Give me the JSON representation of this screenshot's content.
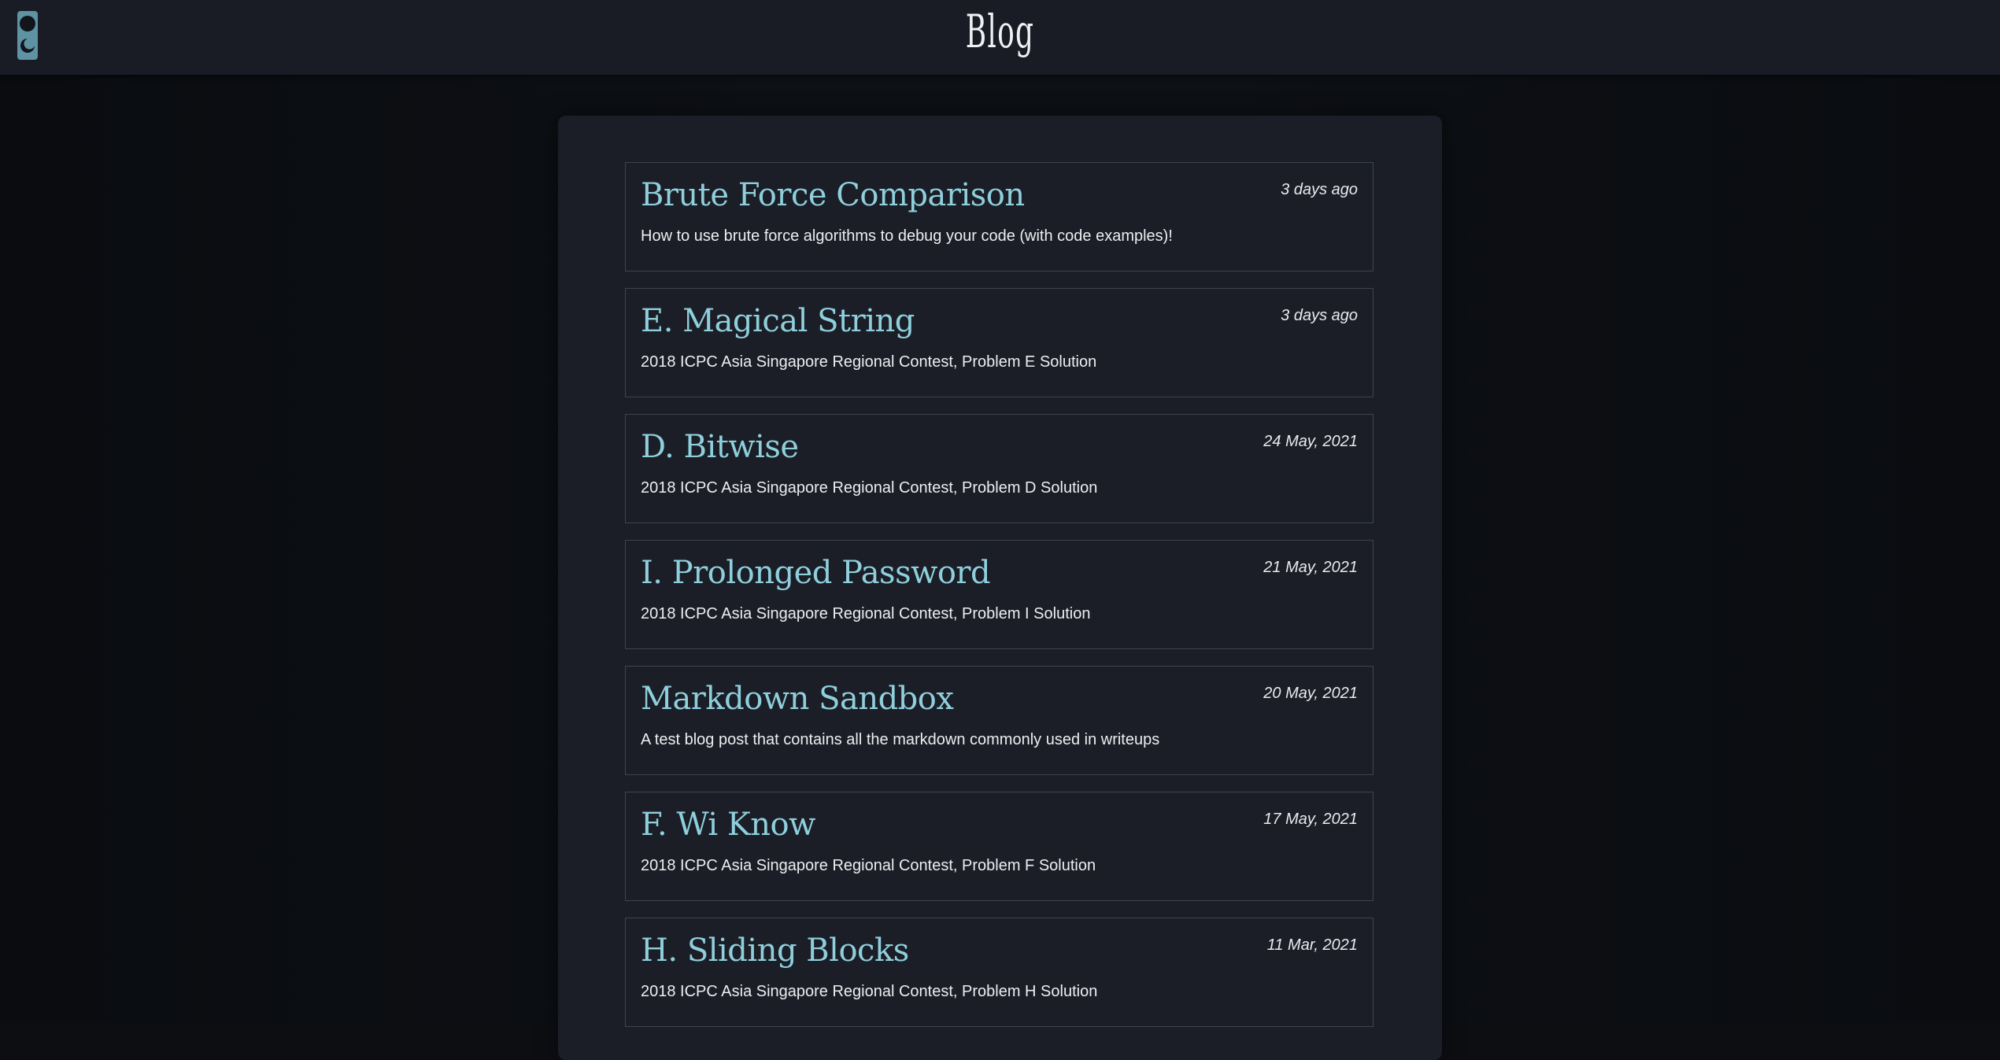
{
  "header": {
    "title": "Blog",
    "theme_toggle_icon": "theme-toggle-icon"
  },
  "colors": {
    "background": "#0c0e12",
    "header": "#191c24",
    "panel": "#1b1e27",
    "accent": "#8fcfdc",
    "toggle": "#5d93a3",
    "border": "#3f4350"
  },
  "posts": [
    {
      "title": "Brute Force Comparison",
      "date": "3 days ago",
      "description": "How to use brute force algorithms to debug your code (with code examples)!"
    },
    {
      "title": "E. Magical String",
      "date": "3 days ago",
      "description": "2018 ICPC Asia Singapore Regional Contest, Problem E Solution"
    },
    {
      "title": "D. Bitwise",
      "date": "24 May, 2021",
      "description": "2018 ICPC Asia Singapore Regional Contest, Problem D Solution"
    },
    {
      "title": "I. Prolonged Password",
      "date": "21 May, 2021",
      "description": "2018 ICPC Asia Singapore Regional Contest, Problem I Solution"
    },
    {
      "title": "Markdown Sandbox",
      "date": "20 May, 2021",
      "description": "A test blog post that contains all the markdown commonly used in writeups"
    },
    {
      "title": "F. Wi Know",
      "date": "17 May, 2021",
      "description": "2018 ICPC Asia Singapore Regional Contest, Problem F Solution"
    },
    {
      "title": "H. Sliding Blocks",
      "date": "11 Mar, 2021",
      "description": "2018 ICPC Asia Singapore Regional Contest, Problem H Solution"
    }
  ]
}
